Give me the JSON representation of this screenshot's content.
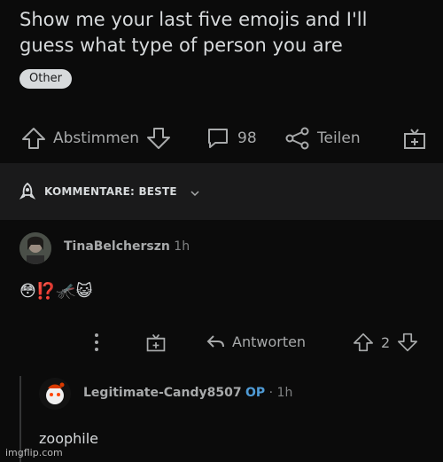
{
  "post": {
    "title": "Show me your last five emojis and I'll guess what type of person you are",
    "flair": "Other"
  },
  "actions": {
    "vote_label": "Abstimmen",
    "comment_count": "98",
    "share_label": "Teilen"
  },
  "sort": {
    "label": "KOMMENTARE: BESTE"
  },
  "comments": [
    {
      "username": "TinaBelcherszn",
      "age": "1h",
      "body_emojis": "😳⁉️🦟😺",
      "reply_label": "Antworten",
      "score": "2"
    },
    {
      "username": "Legitimate-Candy8507",
      "op_badge": "OP",
      "separator": "·",
      "age": "1h",
      "body": "zoophile"
    }
  ],
  "watermark": "imgflip.com",
  "colors": {
    "background": "#0b0b0b",
    "sortbar": "#1a1a1b",
    "op_blue": "#4f9bd6"
  }
}
